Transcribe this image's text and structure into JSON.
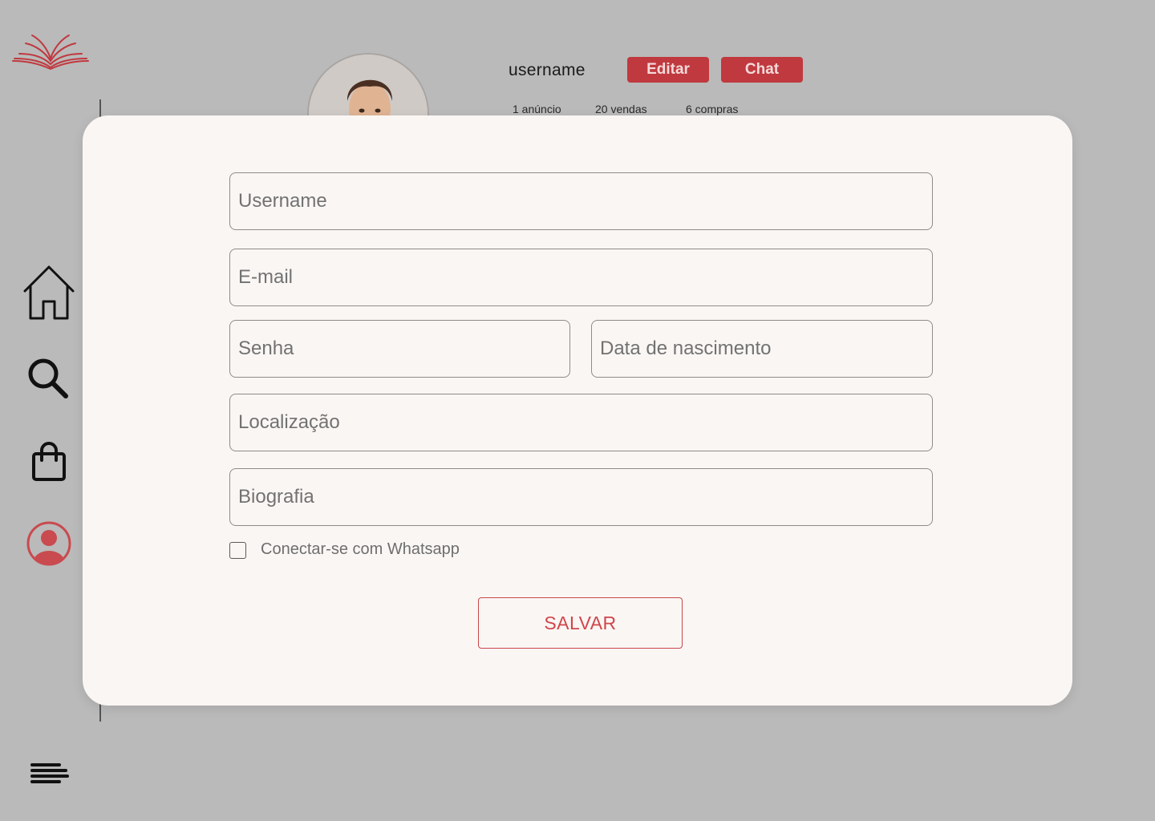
{
  "profile": {
    "username": "username",
    "edit_label": "Editar",
    "chat_label": "Chat",
    "stats": [
      "1 anúncio",
      "20 vendas",
      "6 compras"
    ]
  },
  "form": {
    "username_placeholder": "Username",
    "email_placeholder": "E-mail",
    "password_placeholder": "Senha",
    "birthdate_placeholder": "Data de nascimento",
    "location_placeholder": "Localização",
    "bio_placeholder": "Biografia",
    "whatsapp_label": "Conectar-se com Whatsapp",
    "whatsapp_checked": false,
    "save_label": "SALVAR"
  },
  "sidebar": {
    "items": [
      {
        "icon": "home-icon"
      },
      {
        "icon": "search-icon"
      },
      {
        "icon": "shopping-bag-icon"
      },
      {
        "icon": "profile-icon",
        "active": true
      }
    ],
    "menu_icon": "menu-icon"
  },
  "colors": {
    "accent": "#c0393f",
    "background": "#bababa",
    "modal_bg": "#faf6f4",
    "active_icon": "#c94a4f"
  }
}
